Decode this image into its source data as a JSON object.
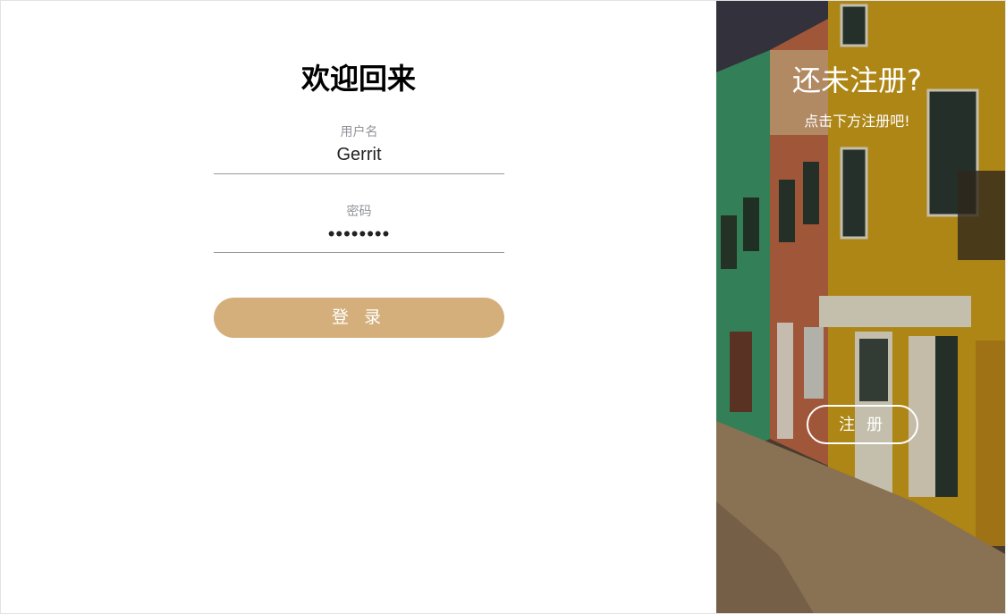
{
  "login": {
    "title": "欢迎回来",
    "username_label": "用户名",
    "username_value": "Gerrit",
    "password_label": "密码",
    "password_value": "••••••••",
    "login_button": "登 录"
  },
  "signup": {
    "title": "还未注册?",
    "subtitle": "点击下方注册吧!",
    "register_button": "注 册"
  },
  "colors": {
    "login_button": "#d4af7b",
    "background": "#ffffff",
    "text": "#000000"
  }
}
